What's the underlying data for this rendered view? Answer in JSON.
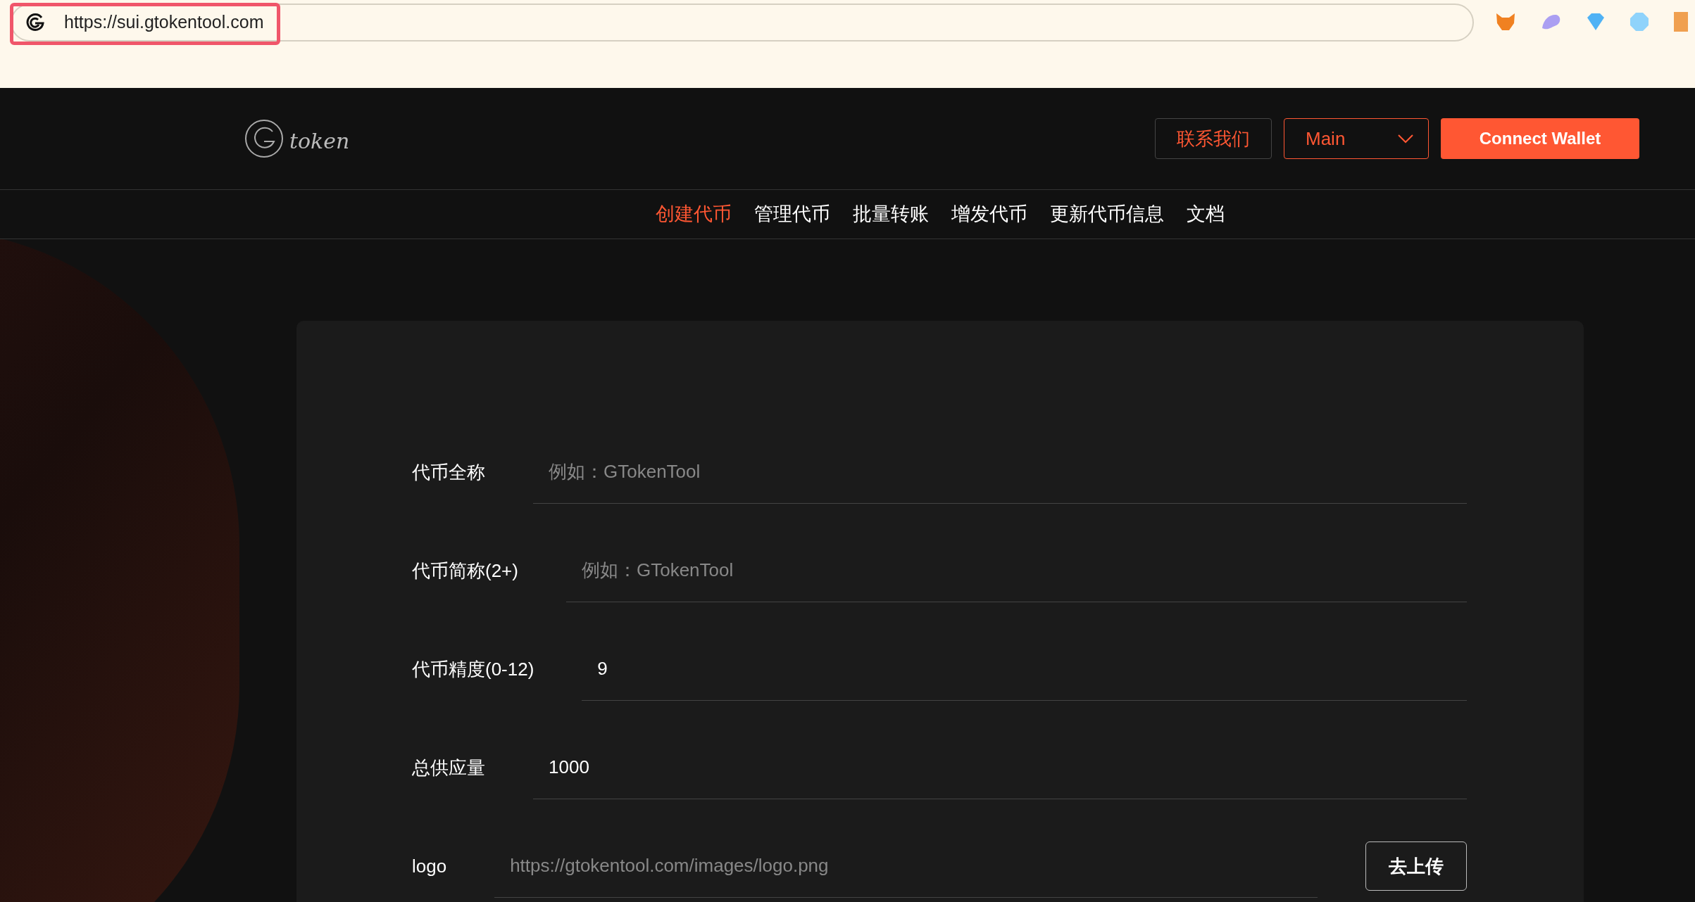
{
  "browser": {
    "url": "https://sui.gtokentool.com"
  },
  "header": {
    "logo_text": "token",
    "contact_button": "联系我们",
    "network_select": {
      "value": "Main"
    },
    "connect_button": "Connect Wallet"
  },
  "nav": [
    {
      "label": "创建代币",
      "selected": true
    },
    {
      "label": "管理代币",
      "selected": false
    },
    {
      "label": "批量转账",
      "selected": false
    },
    {
      "label": "增发代币",
      "selected": false
    },
    {
      "label": "更新代币信息",
      "selected": false
    },
    {
      "label": "文档",
      "selected": false
    }
  ],
  "form": {
    "fields": [
      {
        "label": "代币全称",
        "placeholder": "例如：GTokenTool"
      },
      {
        "label": "代币简称(2+)",
        "placeholder": "例如：GTokenTool"
      },
      {
        "label": "代币精度(0-12)",
        "value": "9"
      },
      {
        "label": "总供应量",
        "value": "1000"
      },
      {
        "label": "logo",
        "placeholder": "https://gtokentool.com/images/logo.png",
        "button": "去上传"
      }
    ]
  }
}
